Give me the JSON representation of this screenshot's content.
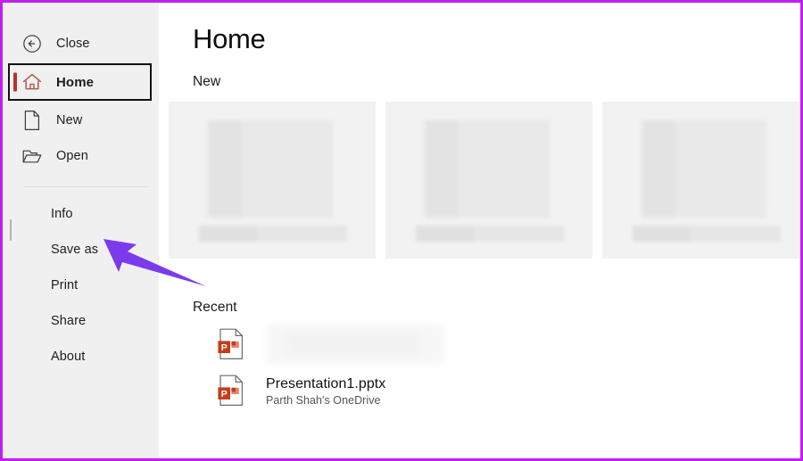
{
  "window": {
    "border_color": "#c11ff0",
    "sidebar_bg": "#f0f0f0",
    "content_bg": "#ffffff",
    "accent_color": "#b7342a"
  },
  "sidebar": {
    "top_items": [
      {
        "id": "close",
        "label": "Close",
        "icon": "back-arrow-circle-icon",
        "selected": false
      },
      {
        "id": "home",
        "label": "Home",
        "icon": "house-icon",
        "selected": true
      },
      {
        "id": "new",
        "label": "New",
        "icon": "document-page-icon",
        "selected": false
      },
      {
        "id": "open",
        "label": "Open",
        "icon": "open-folder-icon",
        "selected": false
      }
    ],
    "sub_items": [
      {
        "id": "info",
        "label": "Info"
      },
      {
        "id": "save-as",
        "label": "Save as"
      },
      {
        "id": "print",
        "label": "Print"
      },
      {
        "id": "share",
        "label": "Share"
      },
      {
        "id": "about",
        "label": "About"
      }
    ]
  },
  "main": {
    "title": "Home",
    "new_section": {
      "heading": "New",
      "templates": [
        {
          "id": "template-1",
          "label": ""
        },
        {
          "id": "template-2",
          "label": ""
        },
        {
          "id": "template-3",
          "label": ""
        }
      ]
    },
    "recent_section": {
      "heading": "Recent",
      "items": [
        {
          "id": "recent-1",
          "name": "",
          "location": "",
          "icon": "powerpoint-file-icon",
          "redacted": true
        },
        {
          "id": "recent-2",
          "name": "Presentation1.pptx",
          "location": "Parth Shah's OneDrive",
          "icon": "powerpoint-file-icon",
          "redacted": false
        }
      ]
    }
  },
  "annotation": {
    "arrow_color": "#7c3aed",
    "points_to": "Save as"
  }
}
